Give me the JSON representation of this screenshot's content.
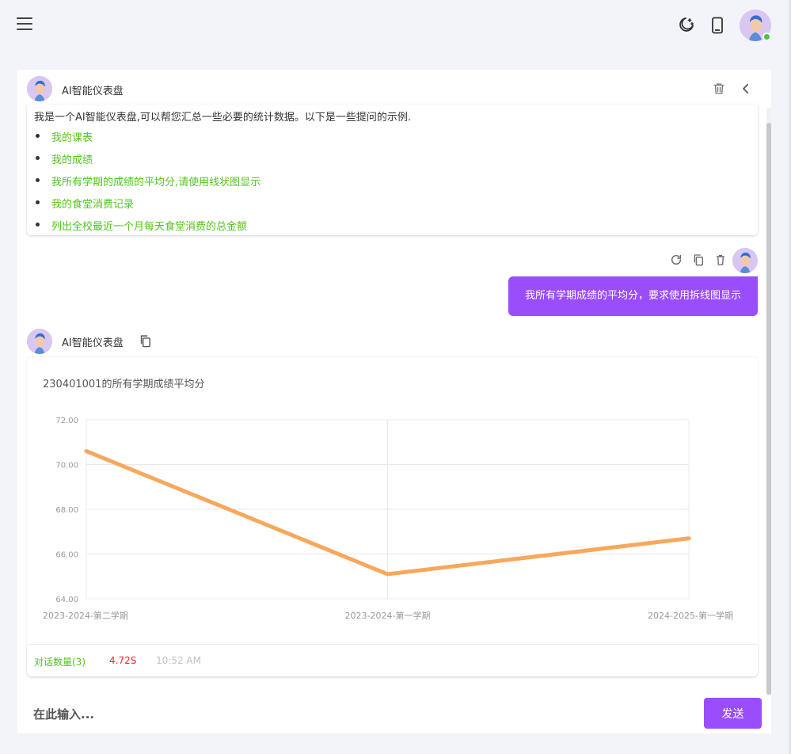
{
  "header": {
    "menu_icon": "menu-icon",
    "icons": [
      "moon-star-icon",
      "mobile-phone-icon"
    ],
    "avatar": "user-avatar",
    "online_color": "#4cc43d"
  },
  "chat": {
    "bot_name": "AI智能仪表盘",
    "header_icons": [
      "trash-icon",
      "chevron-left-icon"
    ],
    "intro": {
      "text": "我是一个AI智能仪表盘,可以帮您汇总一些必要的统计数据。以下是一些提问的示例.",
      "suggestions": [
        "我的课表",
        "我的成绩",
        "我所有学期的成绩的平均分,请使用线状图显示",
        "我的食堂消费记录",
        "列出全校最近一个月每天食堂消费的总金额"
      ]
    },
    "user_message": {
      "text": "我所有学期成绩的平均分，要求使用拆线图显示",
      "actions": [
        "refresh-icon",
        "copy-icon",
        "delete-icon"
      ]
    },
    "bot_reply": {
      "name": "AI智能仪表盘",
      "copy_icon": "copy-icon"
    },
    "footer": {
      "count": "对话数量(3)",
      "duration": "4.72S",
      "time": "10:52 AM"
    }
  },
  "input": {
    "placeholder": "在此输入...",
    "send_label": "发送"
  },
  "colors": {
    "accent": "#9a4dfa",
    "success": "#52c41a",
    "danger": "#f5222d",
    "line": "#f7a85c"
  },
  "chart_data": {
    "type": "line",
    "title": "230401001的所有学期成绩平均分",
    "categories": [
      "2023-2024-第二学期",
      "2023-2024-第一学期",
      "2024-2025-第一学期"
    ],
    "series": [
      {
        "values": [
          70.6,
          65.1,
          66.7
        ]
      }
    ],
    "ylim": [
      64,
      72
    ],
    "yticks": [
      "64.00",
      "66.00",
      "68.00",
      "70.00",
      "72.00"
    ],
    "xlabel": "",
    "ylabel": "",
    "grid": true
  }
}
